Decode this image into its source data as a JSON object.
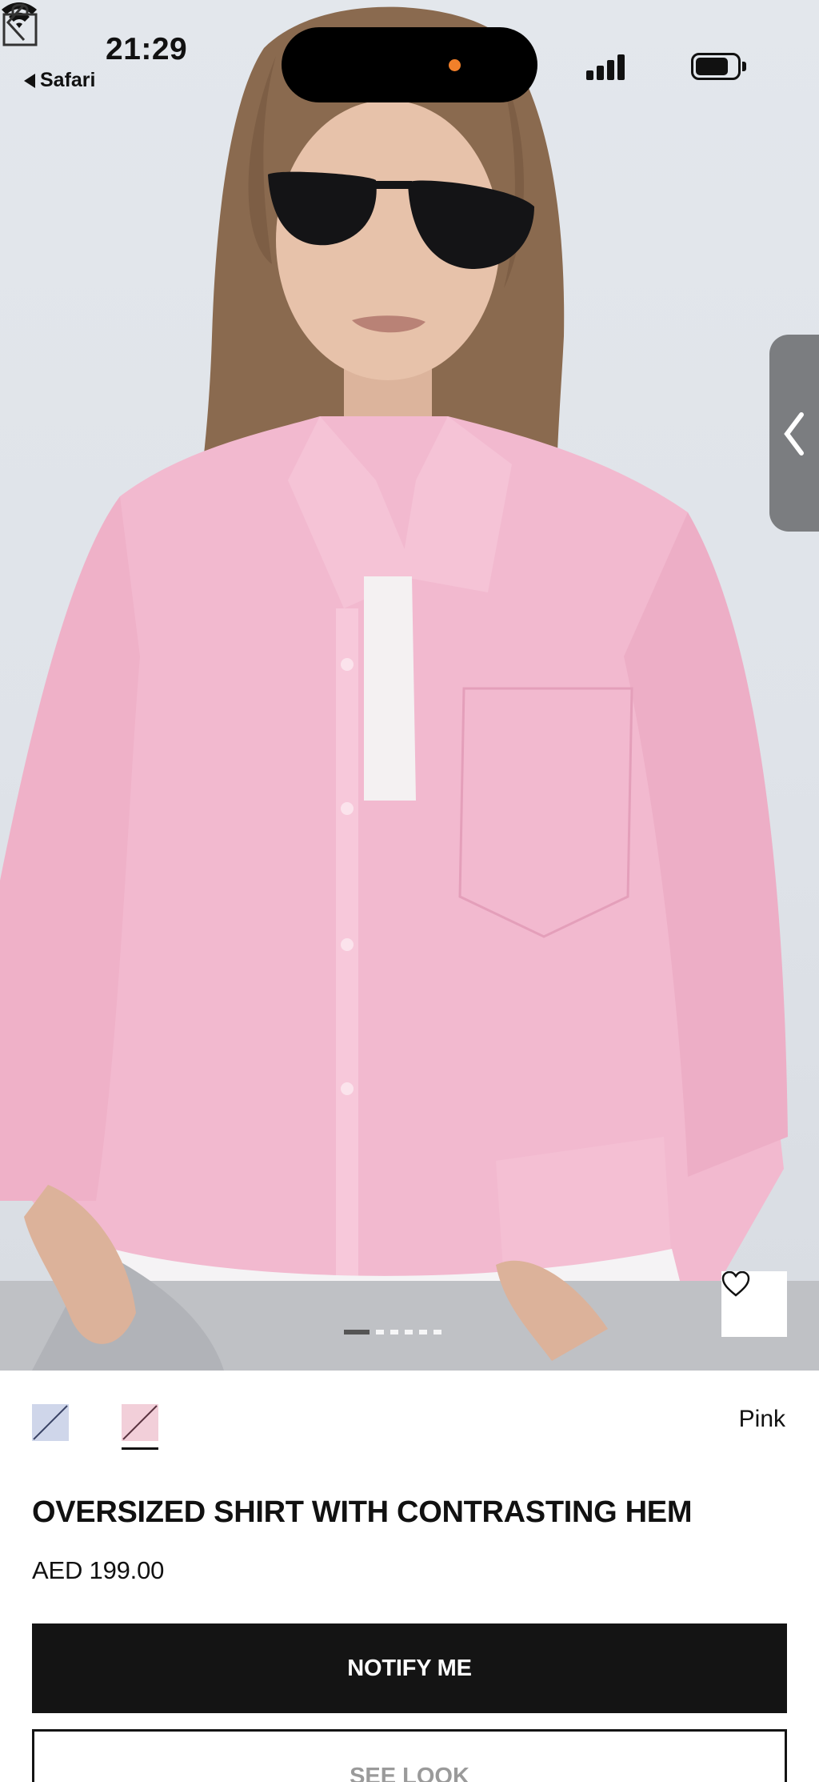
{
  "status_bar": {
    "time": "21:29",
    "back_app_label": "Safari",
    "battery_level": 0.8,
    "signal_bars": 4,
    "recording_dot_color": "#f2802a"
  },
  "gallery": {
    "image_count": 6,
    "active_index": 0
  },
  "product": {
    "colors": [
      {
        "name": "Blue",
        "swatch": "#cfd6ea",
        "selected": false
      },
      {
        "name": "Pink",
        "swatch": "#f2cfd9",
        "selected": true
      }
    ],
    "selected_color_label": "Pink",
    "title": "OVERSIZED SHIRT WITH CONTRASTING HEM",
    "price": "AED 199.00"
  },
  "actions": {
    "notify_label": "NOTIFY ME",
    "see_look_label": "SEE LOOK"
  },
  "icons": {
    "back": "chevron-left-icon",
    "bag": "shopping-bag-icon",
    "handle": "chevron-left-icon",
    "favorite": "heart-icon"
  },
  "theme": {
    "accent": "#141414",
    "background": "#ffffff"
  }
}
